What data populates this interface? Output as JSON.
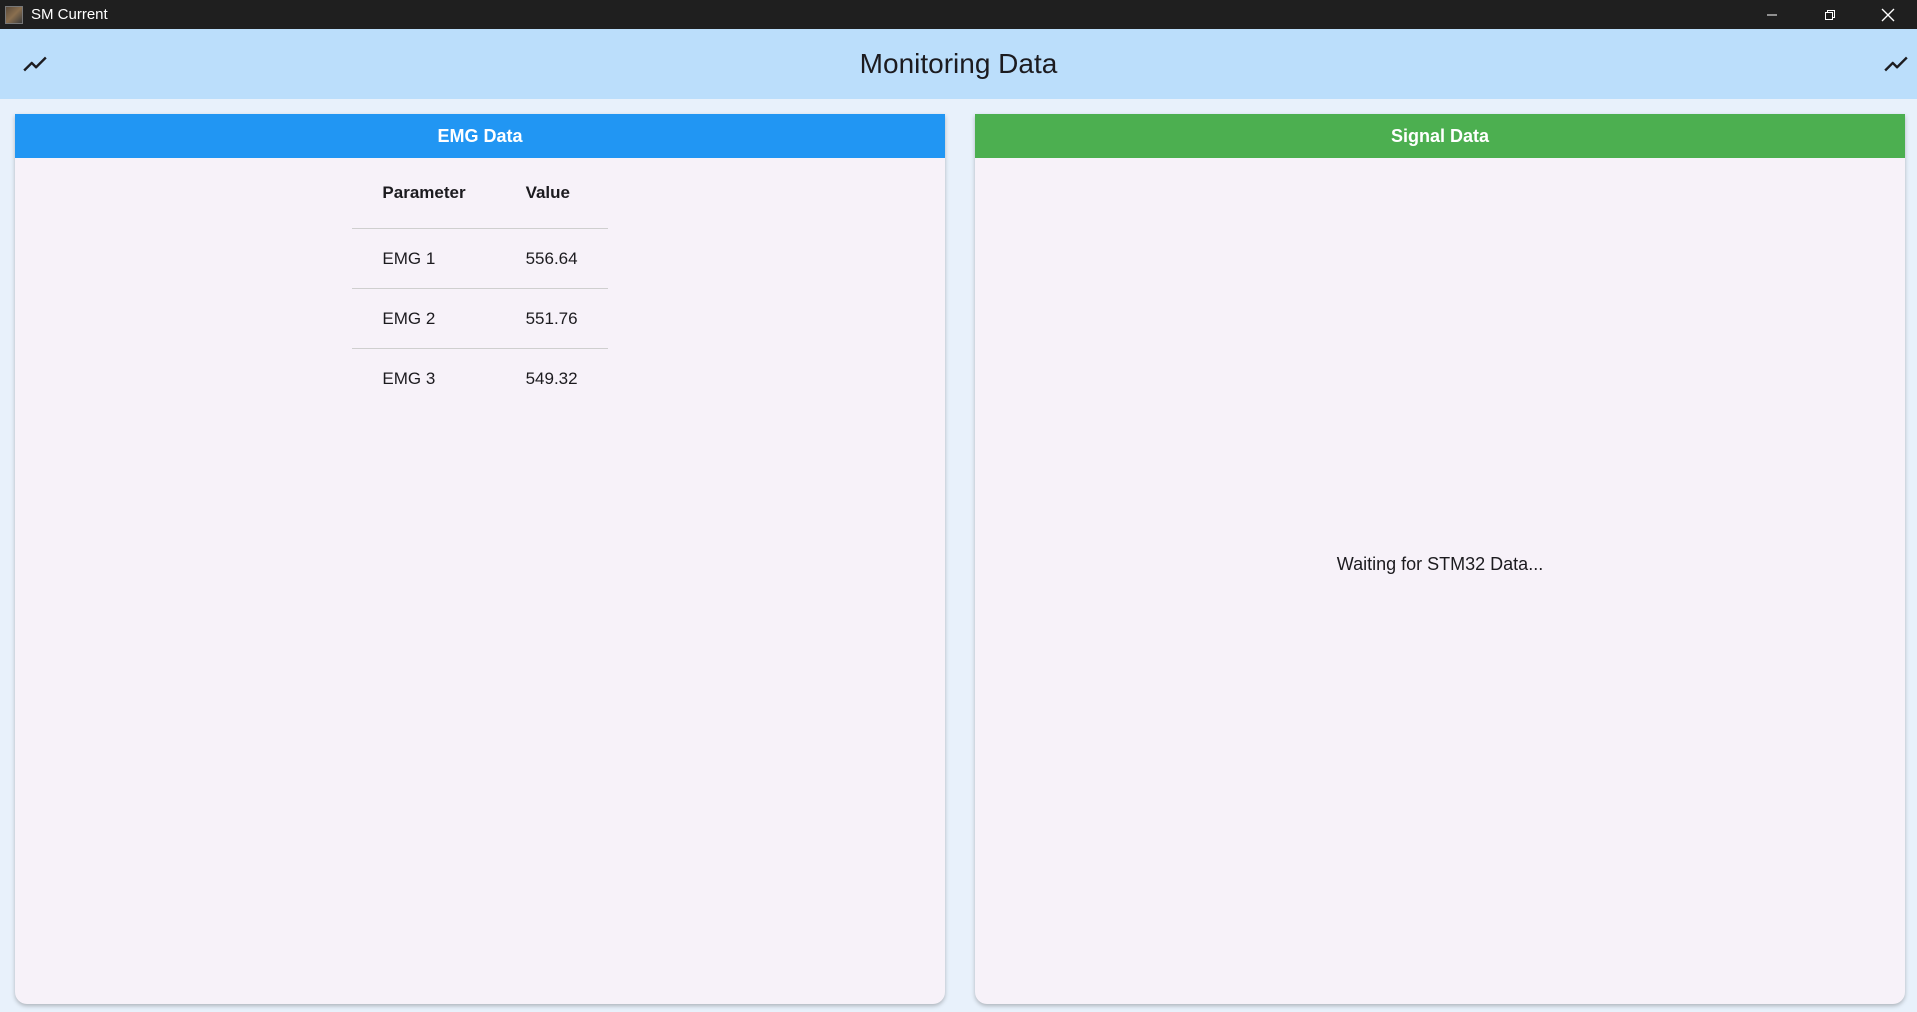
{
  "window": {
    "title": "SM Current",
    "icon": "app-icon",
    "controls": [
      "minimize-icon",
      "restore-icon",
      "close-icon"
    ]
  },
  "appbar": {
    "title": "Monitoring Data",
    "left_icon": "trending-up-icon",
    "right_icon": "trending-up-icon",
    "color": "#bbdefb"
  },
  "emg_card": {
    "title": "EMG Data",
    "header_color": "#2196f3",
    "columns": [
      "Parameter",
      "Value"
    ],
    "rows": [
      {
        "parameter": "EMG 1",
        "value": "556.64"
      },
      {
        "parameter": "EMG 2",
        "value": "551.76"
      },
      {
        "parameter": "EMG 3",
        "value": "549.32"
      }
    ]
  },
  "signal_card": {
    "title": "Signal Data",
    "header_color": "#4caf50",
    "status": "Waiting for STM32 Data..."
  }
}
